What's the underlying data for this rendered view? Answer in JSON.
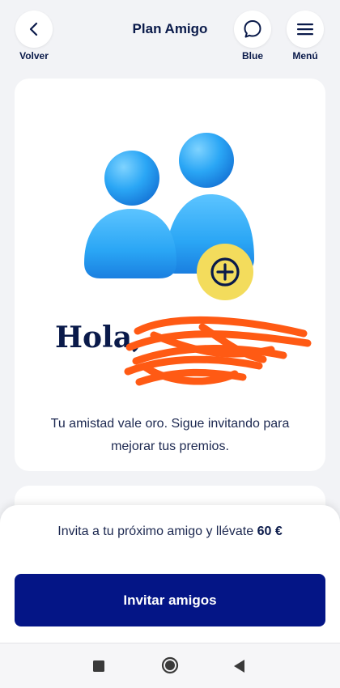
{
  "header": {
    "title": "Plan Amigo",
    "back_label": "Volver",
    "chat_label": "Blue",
    "menu_label": "Menú"
  },
  "hero": {
    "greeting": "Hola,",
    "message": "Tu amistad vale oro. Sigue invitando para mejorar tus premios."
  },
  "invite": {
    "text_prefix": "Invita a tu próximo amigo y llévate",
    "amount": "60 €",
    "button_label": "Invitar amigos"
  },
  "icons": {
    "back": "chevron-left-icon",
    "chat": "chat-bubble-icon",
    "menu": "hamburger-menu-icon",
    "illustration": "users-add-icon",
    "nav_recents": "square-icon",
    "nav_home": "circle-icon",
    "nav_back": "triangle-back-icon"
  },
  "colors": {
    "brand_primary": "#041586",
    "text_dark": "#0a1a4a",
    "accent_yellow": "#f3dc5c",
    "illustration_blue": "#2aa6f5",
    "redaction_orange": "#ff5a14"
  }
}
